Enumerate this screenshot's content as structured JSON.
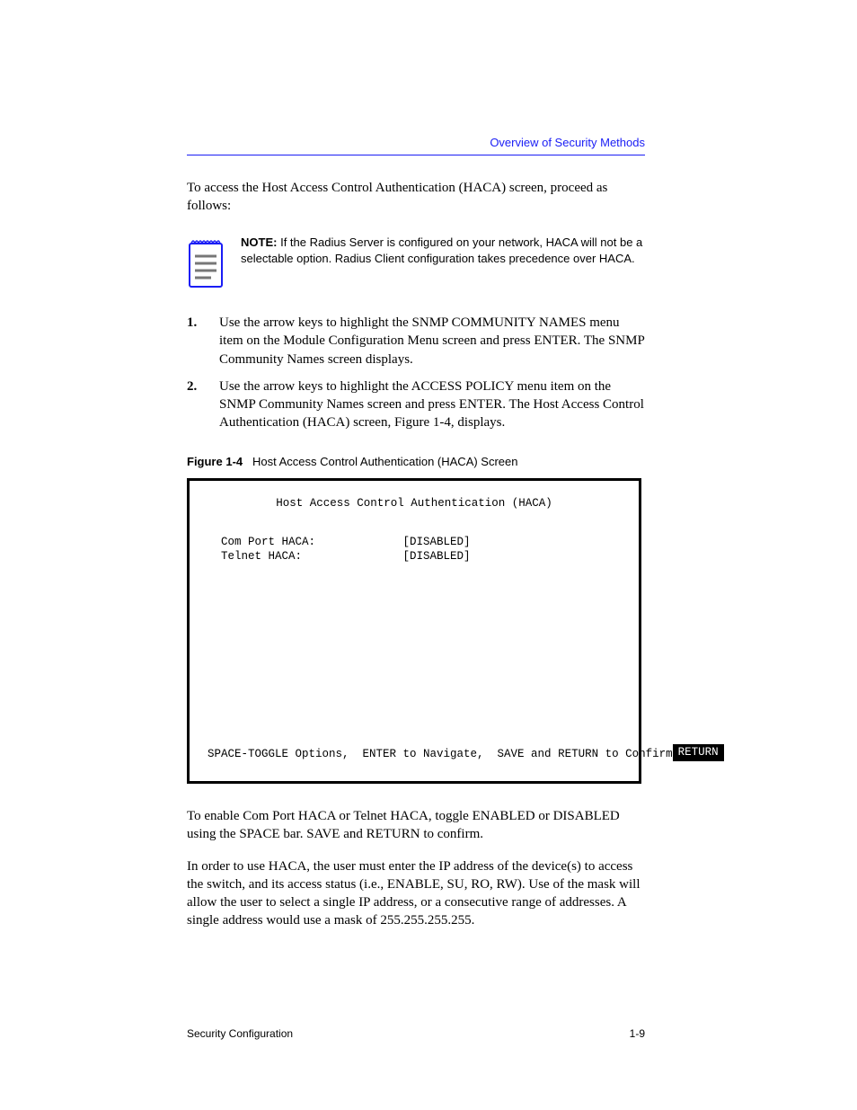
{
  "runningHead": "Overview of Security Methods",
  "intro": "To access the Host Access Control Authentication (HACA) screen, proceed as follows:",
  "note": {
    "label": "NOTE:",
    "text": "If the Radius Server is configured on your network, HACA will not be a selectable option. Radius Client configuration takes precedence over HACA."
  },
  "steps": [
    {
      "num": "1.",
      "text": "Use the arrow keys to highlight the SNMP COMMUNITY NAMES menu item on the Module Configuration Menu screen and press ENTER. The SNMP Community Names screen displays."
    },
    {
      "num": "2.",
      "text": "Use the arrow keys to highlight the ACCESS POLICY menu item on the SNMP Community Names screen and press ENTER. The Host Access Control Authentication (HACA) screen, Figure 1-4, displays."
    }
  ],
  "figure": {
    "lead": "Figure 1-4",
    "caption": "Host Access Control Authentication (HACA) Screen",
    "title": "Host Access Control Authentication (HACA)",
    "lines": [
      "  Com Port HACA:             [DISABLED]",
      "  Telnet HACA:               [DISABLED]",
      ""
    ],
    "help": "SPACE-TOGGLE Options,  ENTER to Navigate,  SAVE and RETURN to Confirm",
    "returnLabel": "RETURN"
  },
  "afterFig": {
    "p1": "To enable Com Port HACA or Telnet HACA, toggle ENABLED or DISABLED using the SPACE bar. SAVE and RETURN to confirm.",
    "p2": "In order to use HACA, the user must enter the IP address of the device(s) to access the switch, and its access status (i.e., ENABLE, SU, RO, RW). Use of the mask will allow the user to select a single IP address, or a consecutive range of addresses. A single address would use a mask of 255.255.255.255."
  },
  "footer": {
    "left": "Security Configuration",
    "right": "1-9"
  }
}
